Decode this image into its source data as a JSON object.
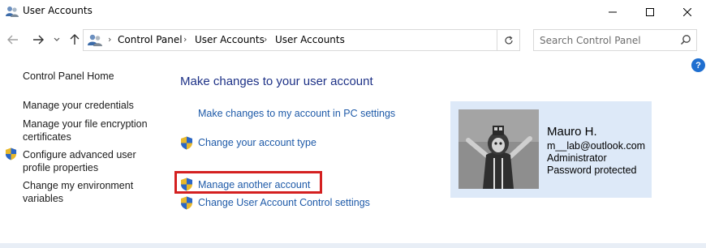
{
  "window": {
    "title": "User Accounts"
  },
  "nav": {
    "breadcrumb": [
      "Control Panel",
      "User Accounts",
      "User Accounts"
    ],
    "search_placeholder": "Search Control Panel"
  },
  "sidebar": {
    "items": [
      {
        "label": "Control Panel Home"
      },
      {
        "label": "Manage your credentials"
      },
      {
        "label": "Manage your file encryption certificates",
        "line1": "Manage your file encryption",
        "line2": "certificates"
      },
      {
        "label": "Configure advanced user profile properties",
        "line1": "Configure advanced user",
        "line2": "profile properties",
        "icon": "uac-shield-icon"
      },
      {
        "label": "Change my environment variables",
        "line1": "Change my environment",
        "line2": "variables"
      }
    ]
  },
  "main": {
    "heading": "Make changes to your user account",
    "tasks": [
      {
        "label": "Make changes to my account in PC settings",
        "icon": null
      },
      {
        "label": "Change your account type",
        "icon": "uac-shield-icon"
      },
      {
        "label": "Manage another account",
        "icon": "uac-shield-icon",
        "highlighted": true
      },
      {
        "label": "Change User Account Control settings",
        "icon": "uac-shield-icon"
      }
    ]
  },
  "user": {
    "name": "Mauro H.",
    "email": "m__lab@outlook.com",
    "role": "Administrator",
    "status": "Password protected"
  },
  "colors": {
    "link": "#1e5aa8",
    "heading": "#1e3287",
    "card_bg": "#dde9f8",
    "highlight": "#d42020"
  }
}
